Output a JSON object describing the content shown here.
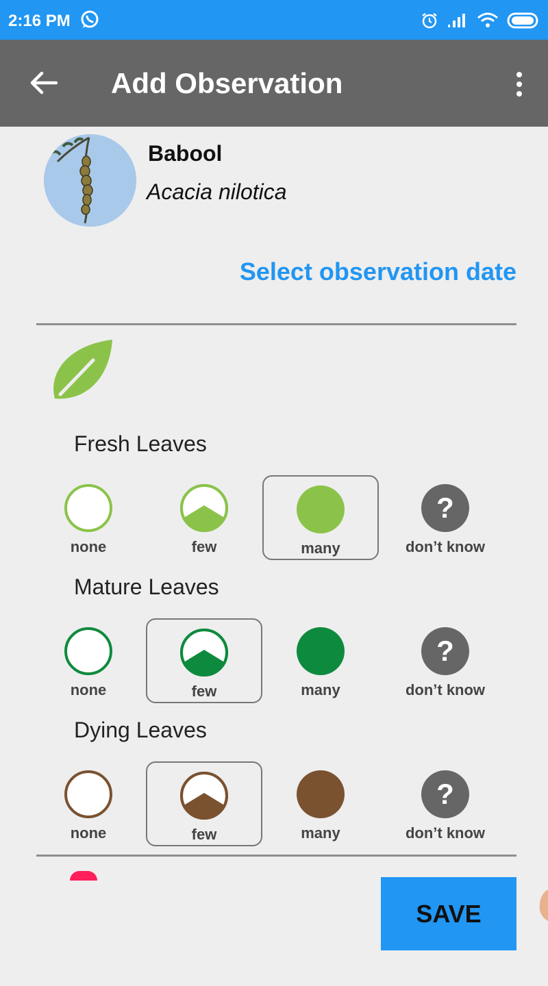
{
  "status_bar": {
    "time": "2:16 PM"
  },
  "app_bar": {
    "title": "Add Observation"
  },
  "species": {
    "common_name": "Babool",
    "scientific_name": "Acacia nilotica"
  },
  "date_link": "Select observation date",
  "phenophases": [
    {
      "label": "Fresh Leaves",
      "color": "#8bc34a",
      "selected": "many",
      "options": [
        "none",
        "few",
        "many",
        "don’t know"
      ]
    },
    {
      "label": "Mature Leaves",
      "color": "#0e8a3e",
      "selected": "few",
      "options": [
        "none",
        "few",
        "many",
        "don’t know"
      ]
    },
    {
      "label": "Dying Leaves",
      "color": "#7a5230",
      "selected": "few",
      "options": [
        "none",
        "few",
        "many",
        "don’t know"
      ]
    }
  ],
  "save_label": "SAVE",
  "colors": {
    "accent": "#2196f3",
    "app_bar": "#666666",
    "leaf_icon": "#8bc34a",
    "unknown": "#666666"
  },
  "icons": [
    "back-arrow-icon",
    "overflow-menu-icon",
    "leaf-icon",
    "question-icon",
    "whatsapp-icon",
    "alarm-icon",
    "signal-icon",
    "wifi-icon",
    "battery-icon"
  ]
}
